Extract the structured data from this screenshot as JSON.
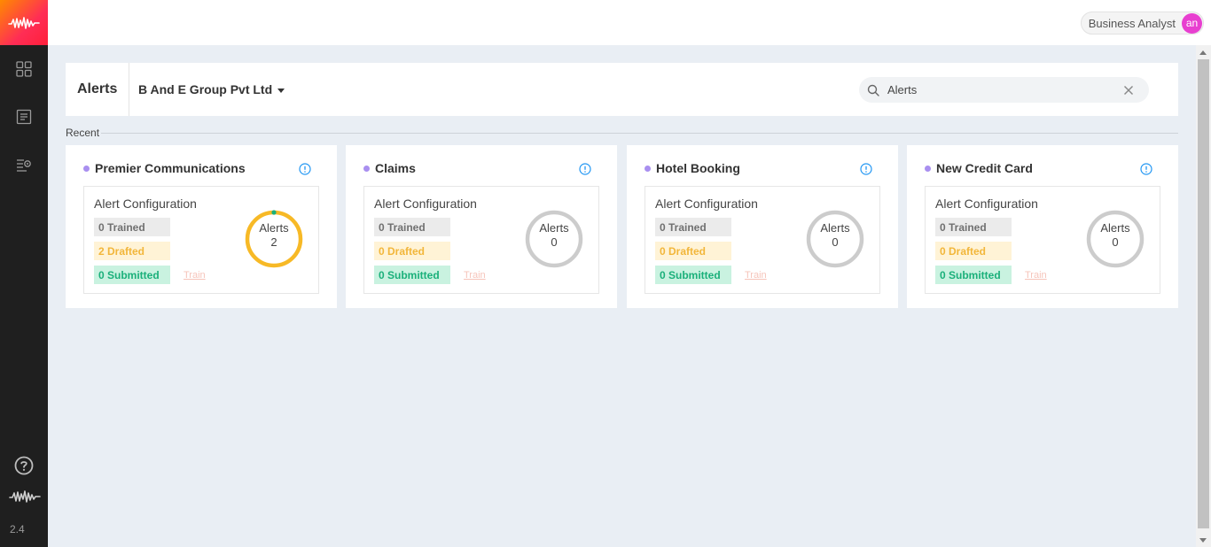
{
  "topbar": {
    "role_label": "Business Analyst",
    "avatar_initials": "an",
    "avatar_color": "#e83fd0"
  },
  "sidebar": {
    "version": "2.4",
    "items": [
      {
        "icon": "grid-icon"
      },
      {
        "icon": "document-list-icon"
      },
      {
        "icon": "list-settings-icon"
      }
    ],
    "bottom": [
      {
        "icon": "help-icon"
      },
      {
        "icon": "waveform-logo-icon"
      }
    ]
  },
  "header": {
    "title": "Alerts",
    "org_name": "B And E Group Pvt Ltd",
    "search": {
      "value": "Alerts",
      "placeholder": ""
    }
  },
  "recent_label": "Recent",
  "cards": [
    {
      "title": "Premier Communications",
      "config_label": "Alert Configuration",
      "trained": "0 Trained",
      "drafted": "2 Drafted",
      "submitted": "0 Submitted",
      "train_link": "Train",
      "ring_label": "Alerts",
      "ring_count": "2",
      "ring_color": "#f7b926"
    },
    {
      "title": "Claims",
      "config_label": "Alert Configuration",
      "trained": "0 Trained",
      "drafted": "0 Drafted",
      "submitted": "0 Submitted",
      "train_link": "Train",
      "ring_label": "Alerts",
      "ring_count": "0",
      "ring_color": "#cccccc"
    },
    {
      "title": "Hotel Booking",
      "config_label": "Alert Configuration",
      "trained": "0 Trained",
      "drafted": "0 Drafted",
      "submitted": "0 Submitted",
      "train_link": "Train",
      "ring_label": "Alerts",
      "ring_count": "0",
      "ring_color": "#cccccc"
    },
    {
      "title": "New Credit Card",
      "config_label": "Alert Configuration",
      "trained": "0 Trained",
      "drafted": "0 Drafted",
      "submitted": "0 Submitted",
      "train_link": "Train",
      "ring_label": "Alerts",
      "ring_count": "0",
      "ring_color": "#cccccc"
    }
  ]
}
